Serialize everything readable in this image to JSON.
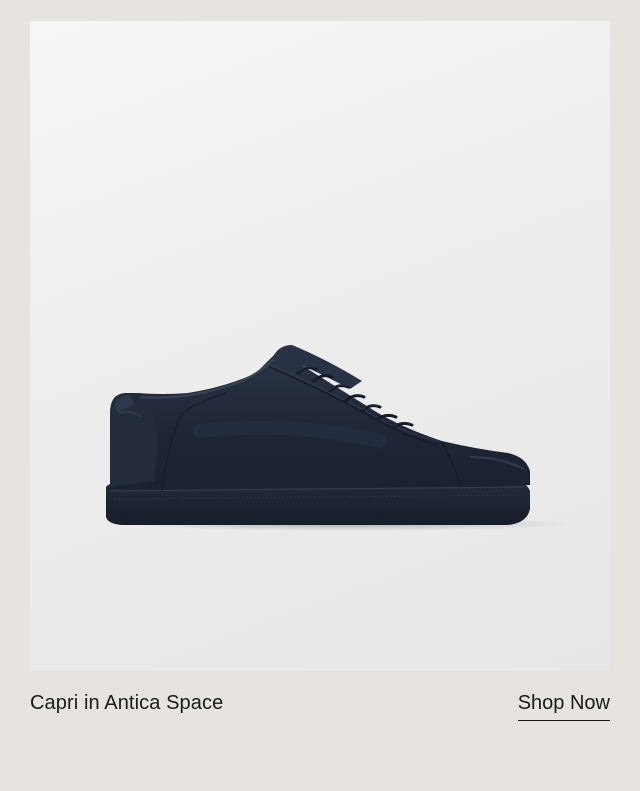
{
  "product": {
    "name": "Capri in Antica Space",
    "image_subject": "sneaker-image",
    "colors": {
      "shoe": "#1f2838",
      "sole": "#1b2230",
      "background": "#e7e4df",
      "image_background": "#eeeeee",
      "text": "#1a1a1a"
    }
  },
  "cta": {
    "label": "Shop Now"
  }
}
